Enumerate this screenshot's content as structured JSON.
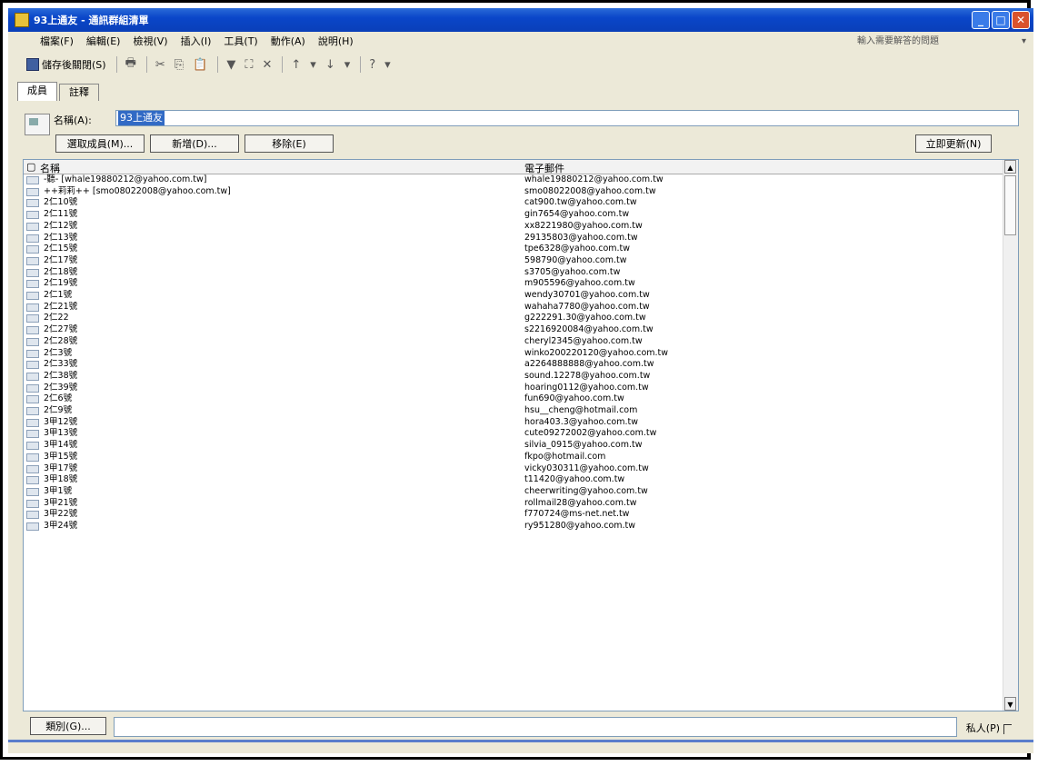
{
  "window": {
    "title": "93上通友 - 通訊群組清單"
  },
  "menu": [
    "檔案(F)",
    "編輯(E)",
    "檢視(V)",
    "插入(I)",
    "工具(T)",
    "動作(A)",
    "說明(H)"
  ],
  "help_search": {
    "placeholder": "輸入需要解答的問題",
    "arrow": "▾"
  },
  "toolbar": {
    "save_close": "儲存後關閉(S)",
    "print": "🖶",
    "cut": "✂",
    "copy": "⎘",
    "paste": "📋",
    "flag": "▼",
    "filter": "⛶",
    "delete": "✕",
    "up": "↑",
    "up_arrow": "▾",
    "down": "↓",
    "down_arrow": "▾",
    "help": "?",
    "help_arrow": "▾"
  },
  "tabs": [
    "成員",
    "註釋"
  ],
  "name_field": {
    "label": "名稱(A):",
    "value": "93上通友"
  },
  "buttons": {
    "select_members": "選取成員(M)...",
    "add_new": "新增(D)...",
    "remove": "移除(E)",
    "update_now": "立即更新(N)"
  },
  "columns": {
    "name": "名稱",
    "email": "電子郵件"
  },
  "members": [
    {
      "name": "-聽- [whale19880212@yahoo.com.tw]",
      "email": "whale19880212@yahoo.com.tw"
    },
    {
      "name": "++莉莉++ [smo08022008@yahoo.com.tw]",
      "email": "smo08022008@yahoo.com.tw"
    },
    {
      "name": "2仁10號",
      "email": "cat900.tw@yahoo.com.tw"
    },
    {
      "name": "2仁11號",
      "email": "gin7654@yahoo.com.tw"
    },
    {
      "name": "2仁12號",
      "email": "xx8221980@yahoo.com.tw"
    },
    {
      "name": "2仁13號",
      "email": "29135803@yahoo.com.tw"
    },
    {
      "name": "2仁15號",
      "email": "tpe6328@yahoo.com.tw"
    },
    {
      "name": "2仁17號",
      "email": "598790@yahoo.com.tw"
    },
    {
      "name": "2仁18號",
      "email": "s3705@yahoo.com.tw"
    },
    {
      "name": "2仁19號",
      "email": "m905596@yahoo.com.tw"
    },
    {
      "name": "2仁1號",
      "email": "wendy30701@yahoo.com.tw"
    },
    {
      "name": "2仁21號",
      "email": "wahaha7780@yahoo.com.tw"
    },
    {
      "name": "2仁22",
      "email": "g222291.30@yahoo.com.tw"
    },
    {
      "name": "2仁27號",
      "email": "s2216920084@yahoo.com.tw"
    },
    {
      "name": "2仁28號",
      "email": "cheryl2345@yahoo.com.tw"
    },
    {
      "name": "2仁3號",
      "email": "winko200220120@yahoo.com.tw"
    },
    {
      "name": "2仁33號",
      "email": "a2264888888@yahoo.com.tw"
    },
    {
      "name": "2仁38號",
      "email": "sound.12278@yahoo.com.tw"
    },
    {
      "name": "2仁39號",
      "email": "hoaring0112@yahoo.com.tw"
    },
    {
      "name": "2仁6號",
      "email": "fun690@yahoo.com.tw"
    },
    {
      "name": "2仁9號",
      "email": "hsu__cheng@hotmail.com"
    },
    {
      "name": "3甲12號",
      "email": "hora403.3@yahoo.com.tw"
    },
    {
      "name": "3甲13號",
      "email": "cute09272002@yahoo.com.tw"
    },
    {
      "name": "3甲14號",
      "email": "silvia_0915@yahoo.com.tw"
    },
    {
      "name": "3甲15號",
      "email": "fkpo@hotmail.com"
    },
    {
      "name": "3甲17號",
      "email": "vicky030311@yahoo.com.tw"
    },
    {
      "name": "3甲18號",
      "email": "t11420@yahoo.com.tw"
    },
    {
      "name": "3甲1號",
      "email": "cheerwriting@yahoo.com.tw"
    },
    {
      "name": "3甲21號",
      "email": "rollmail28@yahoo.com.tw"
    },
    {
      "name": "3甲22號",
      "email": "f770724@ms-net.net.tw"
    },
    {
      "name": "3甲24號",
      "email": "ry951280@yahoo.com.tw"
    }
  ],
  "bottom": {
    "more_button": "類別(G)...",
    "private_label": "私人(P)"
  }
}
